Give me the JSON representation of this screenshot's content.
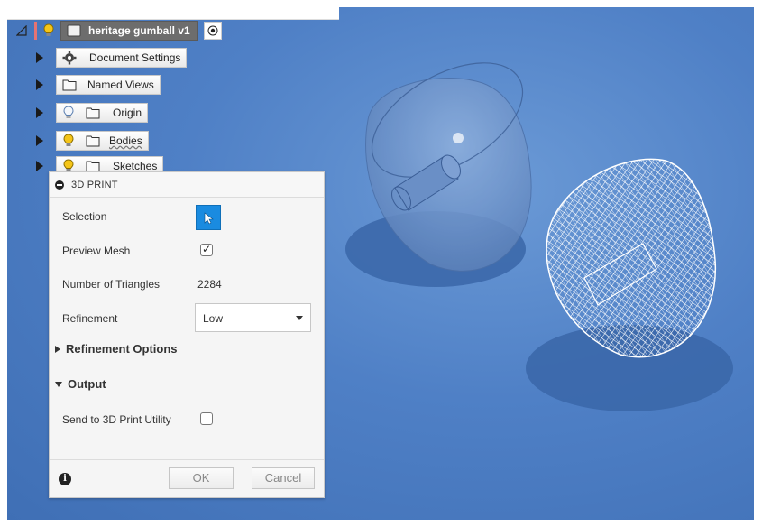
{
  "browser": {
    "root": {
      "label": "heritage gumball v1"
    },
    "items": [
      {
        "label": "Document Settings",
        "icon": "gear-icon"
      },
      {
        "label": "Named Views",
        "icon": "folder-icon"
      },
      {
        "label": "Origin",
        "icon": "folder-icon"
      },
      {
        "label": "Bodies",
        "icon": "folder-icon"
      },
      {
        "label": "Sketches",
        "icon": "folder-icon"
      }
    ]
  },
  "dialog": {
    "title": "3D PRINT",
    "selection_label": "Selection",
    "preview_mesh_label": "Preview Mesh",
    "preview_mesh_checked": true,
    "triangles_label": "Number of Triangles",
    "triangles_value": "2284",
    "refinement_label": "Refinement",
    "refinement_value": "Low",
    "refinement_options_label": "Refinement Options",
    "output_label": "Output",
    "send_label": "Send to 3D Print Utility",
    "send_checked": false,
    "ok_label": "OK",
    "cancel_label": "Cancel"
  },
  "colors": {
    "viewport_bg": "#4f80c6",
    "selection_accent": "#1a8be0",
    "bulb_on": "#f5c518"
  }
}
